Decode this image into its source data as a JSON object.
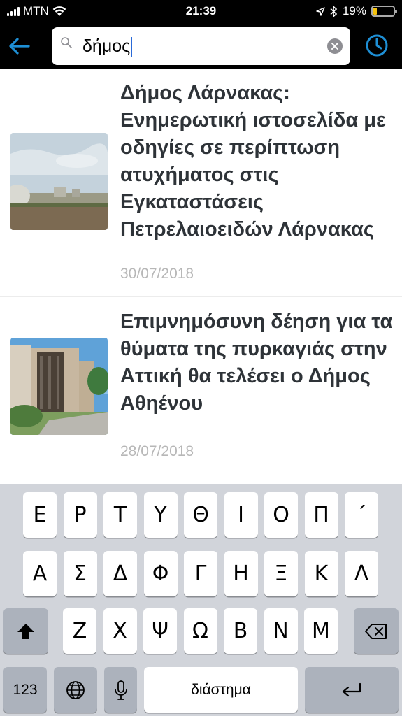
{
  "status_bar": {
    "carrier": "MTN",
    "time": "21:39",
    "battery_percent": "19%",
    "battery_level": 0.19,
    "icons": [
      "signal-icon",
      "wifi-icon",
      "location-icon",
      "bluetooth-icon",
      "battery-icon"
    ]
  },
  "search": {
    "query": "δήμος",
    "icons": [
      "back-arrow-icon",
      "search-icon",
      "clear-icon",
      "history-clock-icon"
    ],
    "accent_color": "#1e8fd5"
  },
  "results": [
    {
      "title": "Δήμος Λάρνακας: Ενημερωτική ιστοσελίδα με οδηγίες σε περίπτωση ατυχήματος στις Εγκαταστάσεις Πετρελαιοειδών Λάρνακας",
      "date": "30/07/2018"
    },
    {
      "title": "Επιμνημόσυνη δέηση για τα θύματα της πυρκαγιάς στην Αττική θα τελέσει ο Δήμος Αθηένου",
      "date": "28/07/2018"
    }
  ],
  "keyboard": {
    "row1": [
      "Ε",
      "Ρ",
      "Τ",
      "Υ",
      "Θ",
      "Ι",
      "Ο",
      "Π",
      "΄"
    ],
    "row2": [
      "Α",
      "Σ",
      "Δ",
      "Φ",
      "Γ",
      "Η",
      "Ξ",
      "Κ",
      "Λ"
    ],
    "row3": [
      "Ζ",
      "Χ",
      "Ψ",
      "Ω",
      "Β",
      "Ν",
      "Μ"
    ],
    "numbers_label": "123",
    "space_label": "διάστημα"
  }
}
